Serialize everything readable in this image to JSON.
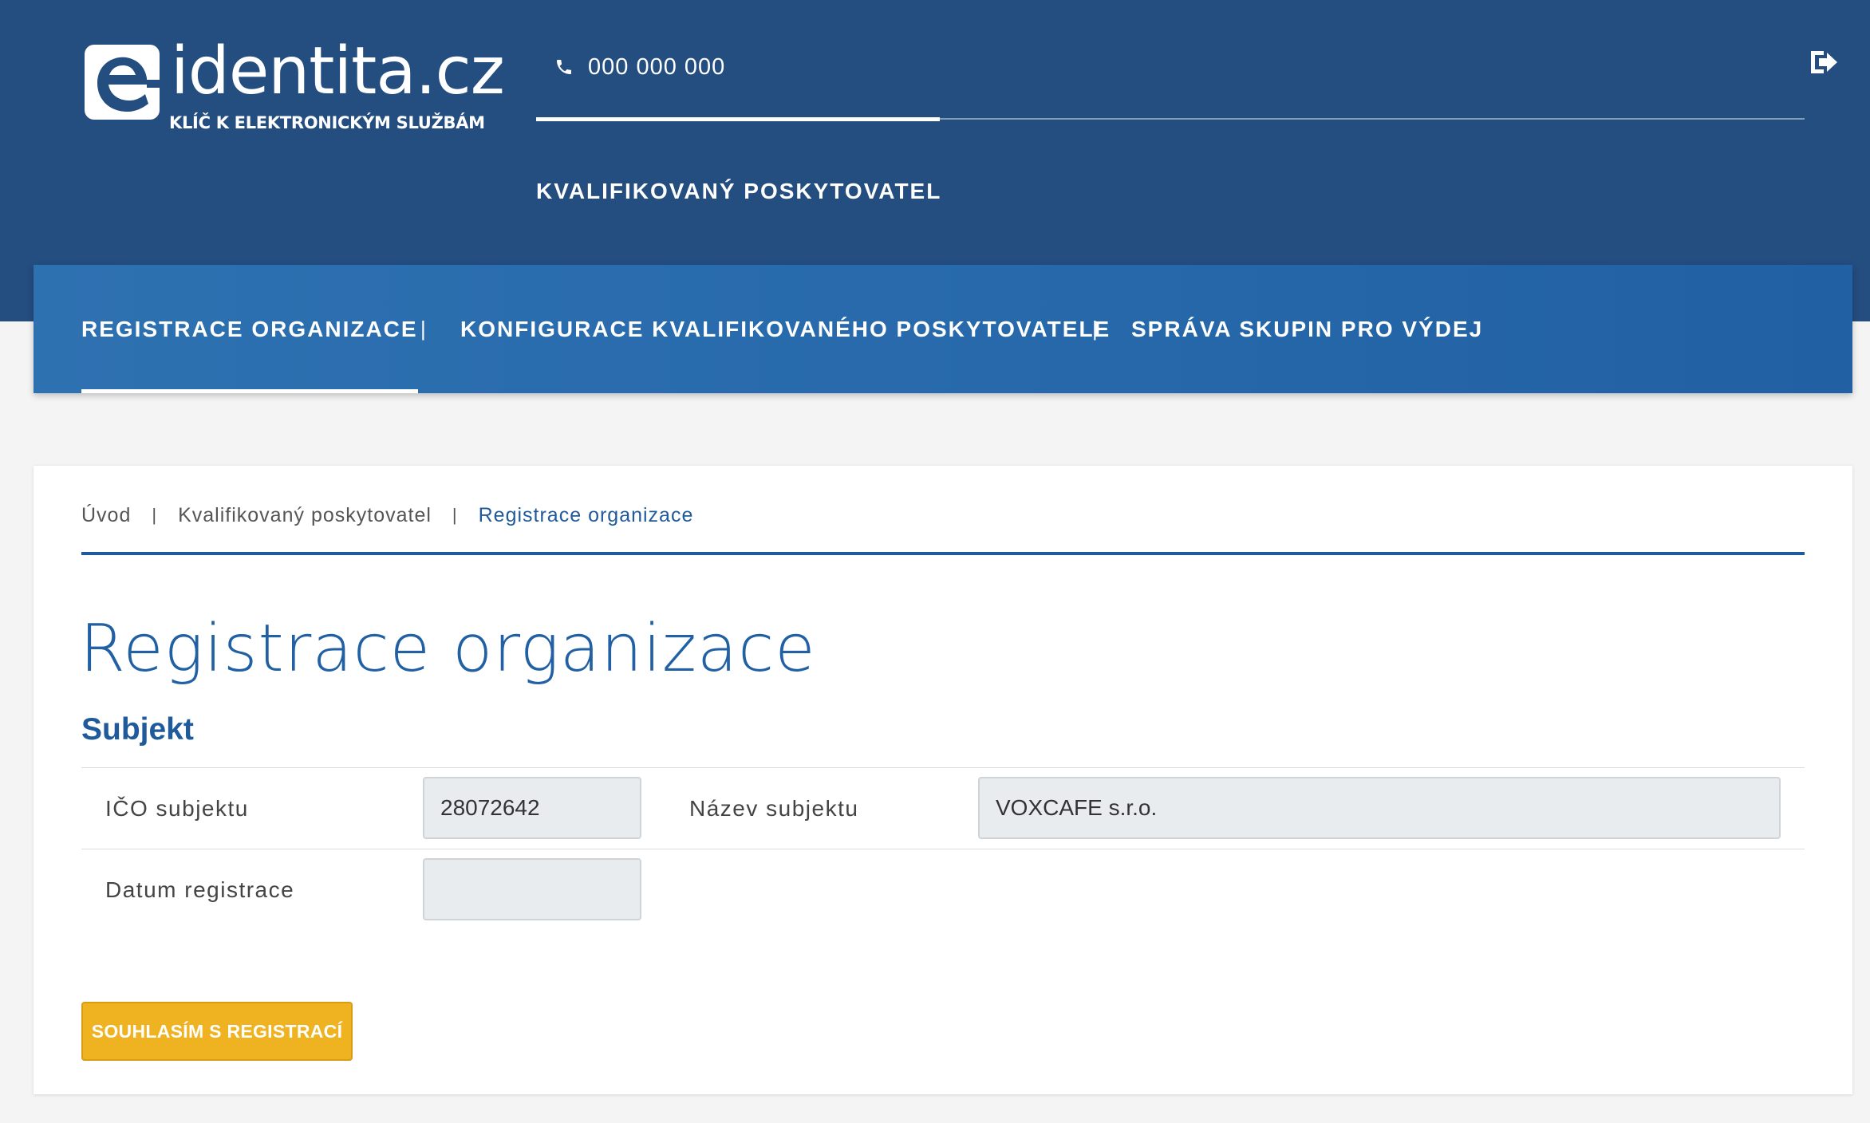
{
  "header": {
    "logo": {
      "brand": "identita.cz",
      "tagline": "KLÍČ K ELEKTRONICKÝM SLUŽBÁM"
    },
    "phone": "000 000 000",
    "role": "KVALIFIKOVANÝ POSKYTOVATEL",
    "icons": {
      "phone": "phone-icon",
      "logout": "logout-icon",
      "logo": "e-logo-icon"
    }
  },
  "nav": {
    "items": [
      {
        "label": "REGISTRACE ORGANIZACE",
        "active": true
      },
      {
        "label": "KONFIGURACE KVALIFIKOVANÉHO POSKYTOVATELE",
        "active": false
      },
      {
        "label": "SPRÁVA SKUPIN PRO VÝDEJ",
        "active": false
      }
    ],
    "separator": "|"
  },
  "breadcrumb": {
    "items": [
      "Úvod",
      "Kvalifikovaný poskytovatel",
      "Registrace organizace"
    ],
    "separator": "|"
  },
  "page": {
    "title": "Registrace organizace",
    "section_title": "Subjekt"
  },
  "form": {
    "ico_label": "IČO subjektu",
    "ico_value": "28072642",
    "name_label": "Název subjektu",
    "name_value": "VOXCAFE s.r.o.",
    "date_label": "Datum registrace",
    "date_value": ""
  },
  "actions": {
    "submit_label": "SOUHLASÍM S REGISTRACÍ"
  },
  "colors": {
    "header_bg": "#244d80",
    "nav_bg": "#2a6bac",
    "accent": "#1f5a9a",
    "button": "#efb220",
    "page_bg": "#f4f4f4"
  }
}
